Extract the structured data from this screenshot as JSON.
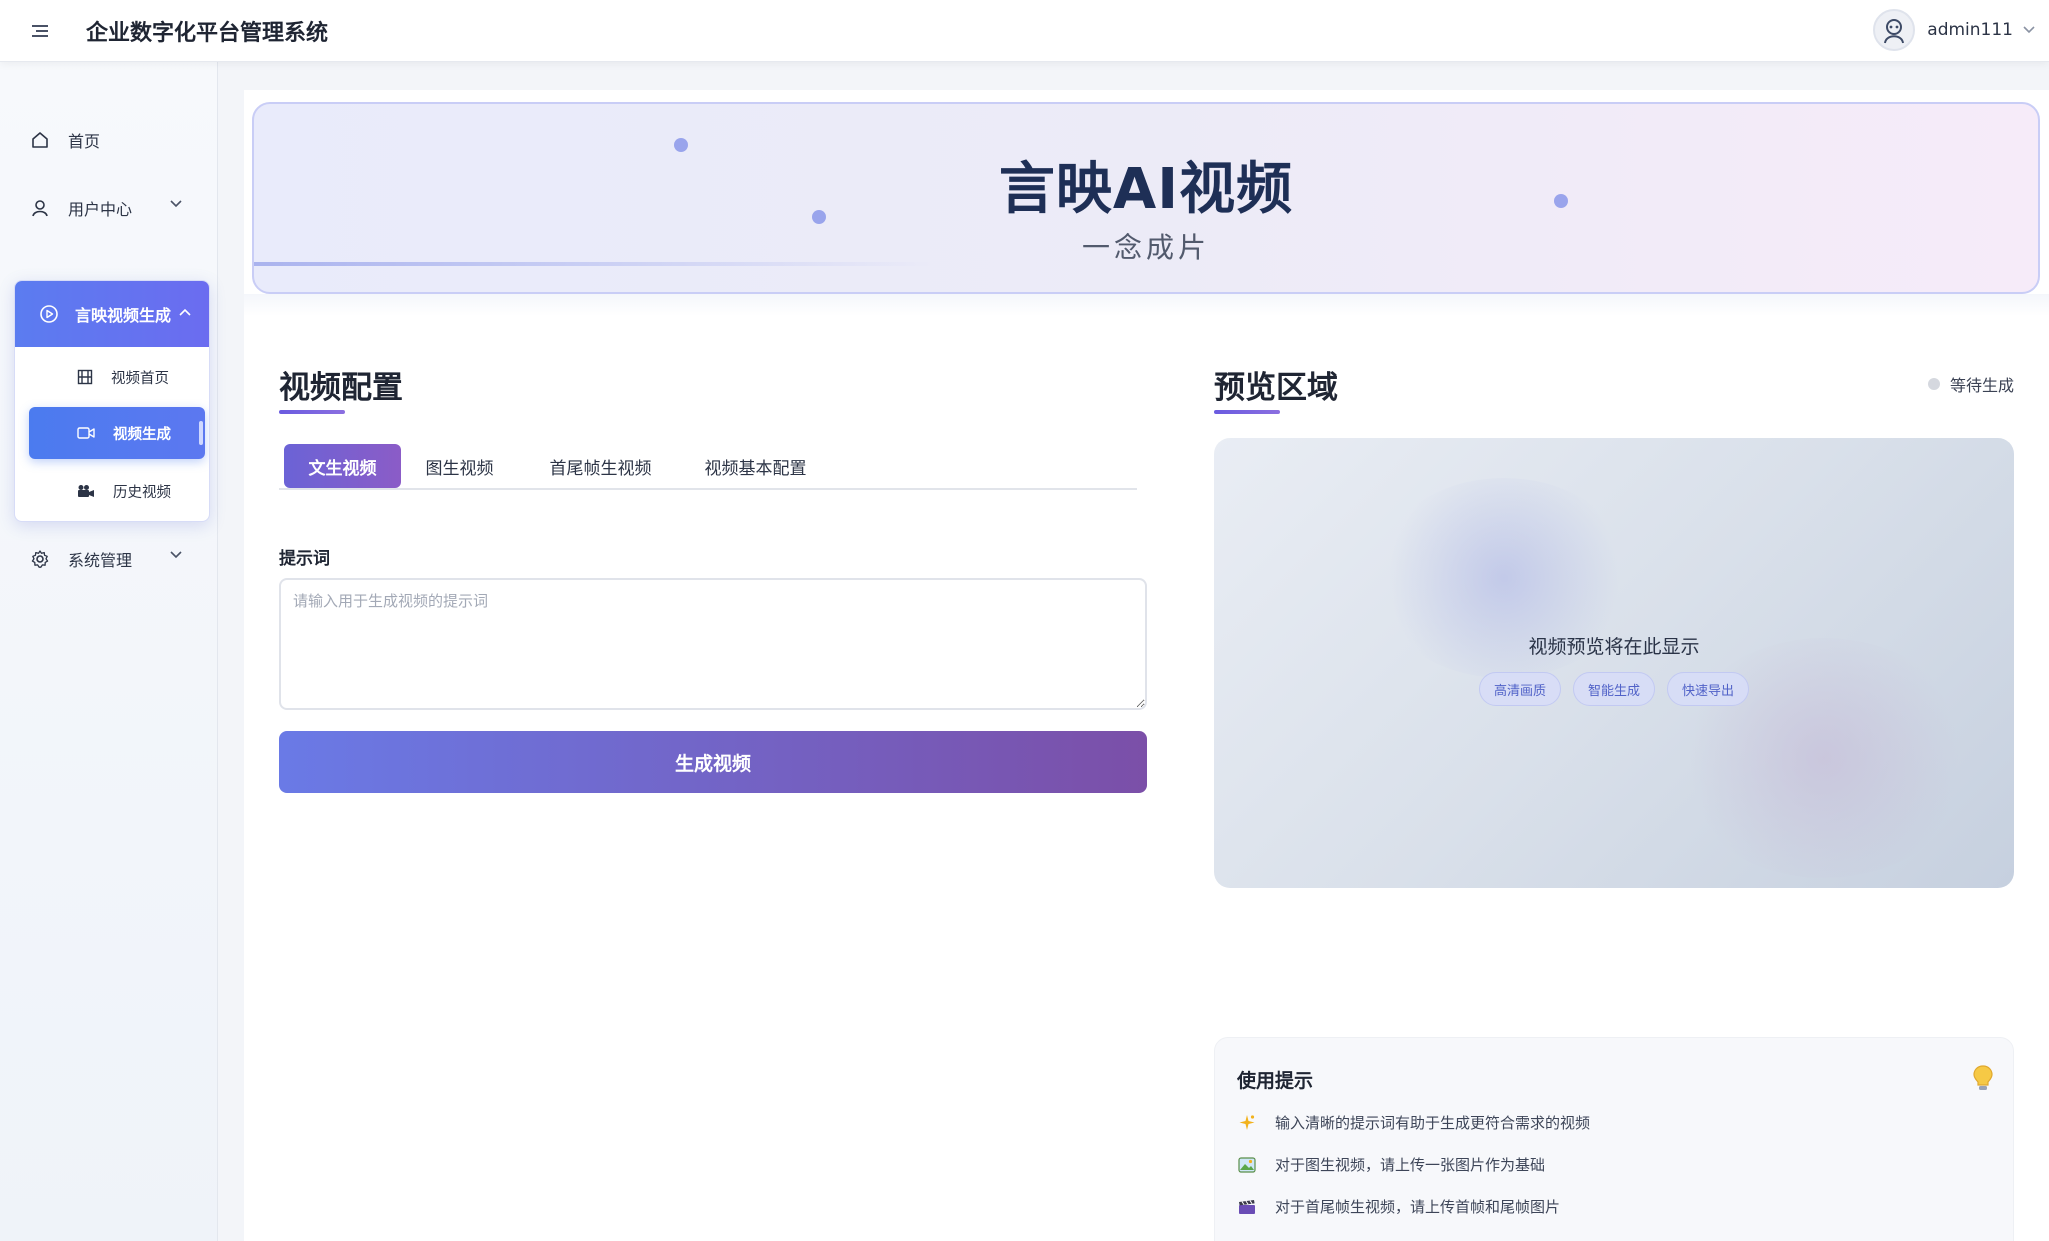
{
  "header": {
    "title": "企业数字化平台管理系统",
    "username": "admin111"
  },
  "sidebar": {
    "items": [
      {
        "label": "首页"
      },
      {
        "label": "用户中心"
      },
      {
        "label": "言映视频生成"
      },
      {
        "label": "系统管理"
      }
    ],
    "submenu": [
      {
        "label": "视频首页"
      },
      {
        "label": "视频生成"
      },
      {
        "label": "历史视频"
      }
    ]
  },
  "hero": {
    "title": "言映AI视频",
    "subtitle": "一念成片"
  },
  "config": {
    "title": "视频配置",
    "tabs": [
      {
        "label": "文生视频"
      },
      {
        "label": "图生视频"
      },
      {
        "label": "首尾帧生视频"
      },
      {
        "label": "视频基本配置"
      }
    ],
    "prompt_label": "提示词",
    "prompt_placeholder": "请输入用于生成视频的提示词",
    "generate_button": "生成视频"
  },
  "preview": {
    "title": "预览区域",
    "status": "等待生成",
    "placeholder_text": "视频预览将在此显示",
    "chips": [
      "高清画质",
      "智能生成",
      "快速导出"
    ]
  },
  "tips": {
    "title": "使用提示",
    "items": [
      {
        "icon": "sparkles-icon",
        "text": "输入清晰的提示词有助于生成更符合需求的视频"
      },
      {
        "icon": "image-icon",
        "text": "对于图生视频，请上传一张图片作为基础"
      },
      {
        "icon": "clapper-icon",
        "text": "对于首尾帧生视频，请上传首帧和尾帧图片"
      }
    ]
  },
  "colors": {
    "accent_blue": "#4b7bef",
    "accent_purple": "#6b63d6",
    "title_dark": "#1e2f56"
  }
}
